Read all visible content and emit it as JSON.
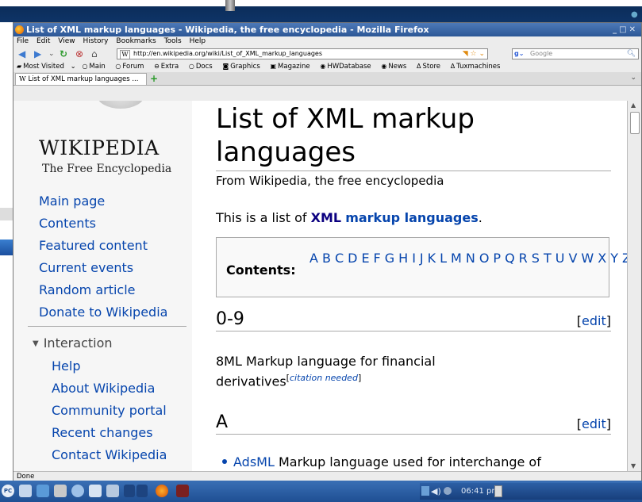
{
  "browser": {
    "title": "List of XML markup languages - Wikipedia, the free encyclopedia - Mozilla Firefox",
    "menu": [
      "File",
      "Edit",
      "View",
      "History",
      "Bookmarks",
      "Tools",
      "Help"
    ],
    "url": "http://en.wikipedia.org/wiki/List_of_XML_markup_languages",
    "url_site_icon": "W",
    "search_placeholder": "Google",
    "bookmarks": [
      "Most Visited",
      "Main",
      "Forum",
      "Extra",
      "Docs",
      "Graphics",
      "Magazine",
      "HWDatabase",
      "News",
      "Store",
      "Tuxmachines"
    ],
    "tab_label": "List of XML markup languages ...",
    "status": "Done"
  },
  "sidebar": {
    "logo_title": "WIKIPEDIA",
    "logo_subtitle": "The Free Encyclopedia",
    "nav": [
      "Main page",
      "Contents",
      "Featured content",
      "Current events",
      "Random article",
      "Donate to Wikipedia"
    ],
    "interaction_heading": "Interaction",
    "interaction": [
      "Help",
      "About Wikipedia",
      "Community portal",
      "Recent changes",
      "Contact Wikipedia"
    ]
  },
  "article": {
    "title": "List of XML markup languages",
    "from": "From Wikipedia, the free encyclopedia",
    "intro_prefix": "This is a list of ",
    "intro_link1": "XML",
    "intro_link2": "markup languages",
    "intro_suffix": ".",
    "toc_label": "Contents:",
    "toc_letters": [
      "A",
      "B",
      "C",
      "D",
      "E",
      "F",
      "G",
      "H",
      "I",
      "J",
      "K",
      "L",
      "M",
      "N",
      "O",
      "P",
      "Q",
      "R",
      "S",
      "T",
      "U",
      "V",
      "W",
      "X",
      "Y",
      "Z"
    ],
    "section1": "0-9",
    "section1_text": "8ML Markup language for financial derivatives",
    "citation": "citation needed",
    "section2": "A",
    "edit_label": "edit",
    "item_a_link": "AdsML",
    "item_a_text": " Markup language used for interchange of"
  },
  "taskbar": {
    "start_label": "PC",
    "clock": "06:41 pm"
  },
  "colors": {
    "link": "#0645ad",
    "titlebar": "#2c5796",
    "taskbar": "#1f4f93"
  }
}
